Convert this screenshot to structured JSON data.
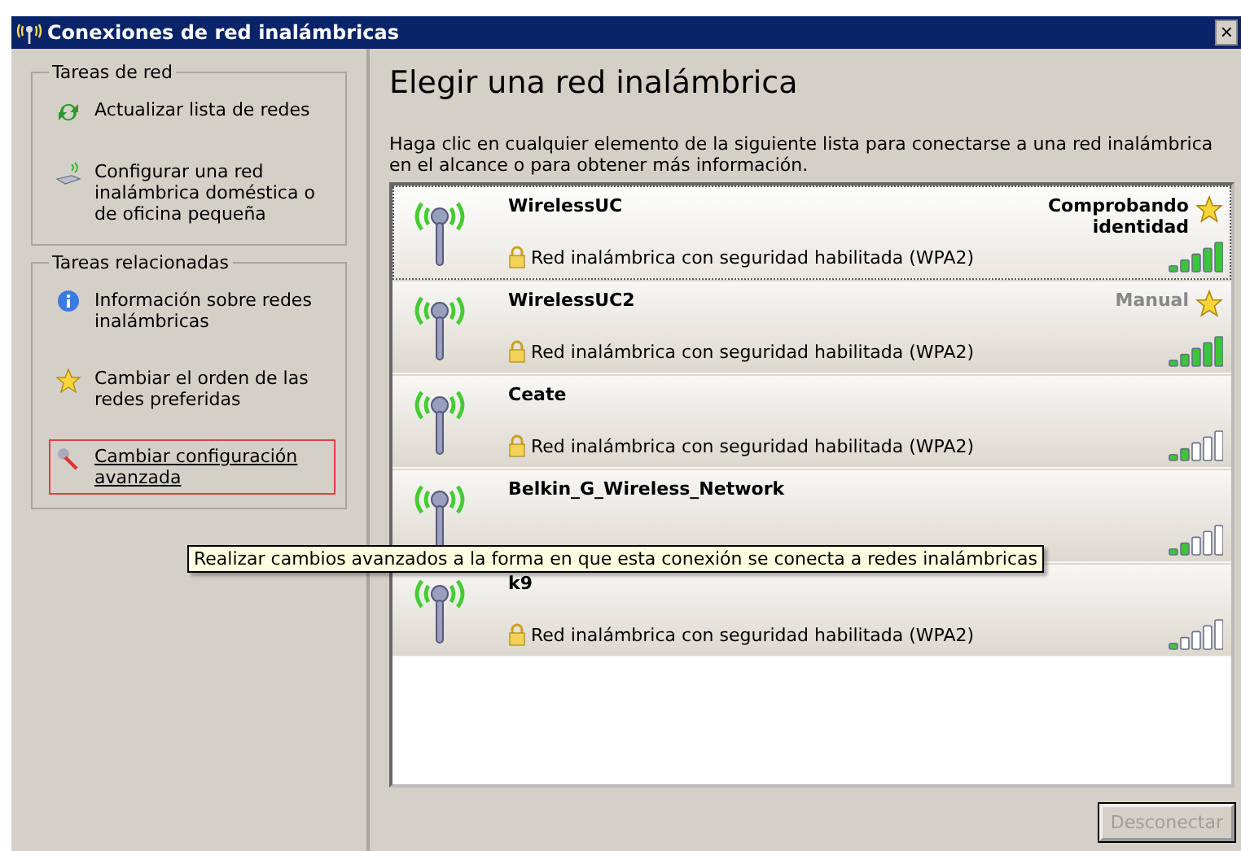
{
  "window": {
    "title": "Conexiones de red inalámbricas",
    "close": "×"
  },
  "sidebar": [
    {
      "title": "Tareas de red",
      "items": [
        {
          "kind": "refresh",
          "label": "Actualizar lista de redes",
          "highlighted": false
        },
        {
          "kind": "setup",
          "label": "Configurar una red inalámbrica doméstica o de oficina pequeña",
          "highlighted": false
        }
      ]
    },
    {
      "title": "Tareas relacionadas",
      "items": [
        {
          "kind": "info",
          "label": "Información sobre redes inalámbricas",
          "highlighted": false
        },
        {
          "kind": "star",
          "label": "Cambiar el orden de las redes preferidas",
          "highlighted": false
        },
        {
          "kind": "tools",
          "label": "Cambiar configuración avanzada",
          "highlighted": true
        }
      ]
    }
  ],
  "heading": "Elegir una red inalámbrica",
  "description": "Haga clic en cualquier elemento de la siguiente lista para conectarse a una red inalámbrica en el alcance o para obtener más información.",
  "networks": [
    {
      "name": "WirelessUC",
      "security": "Red inalámbrica con seguridad habilitada (WPA2)",
      "status": "Comprobando identidad",
      "kind": "active",
      "preferred": true,
      "level": 1,
      "selected": true
    },
    {
      "name": "WirelessUC2",
      "security": "Red inalámbrica con seguridad habilitada (WPA2)",
      "status": "Manual",
      "kind": "muted",
      "preferred": true,
      "level": 1,
      "selected": false
    },
    {
      "name": "Ceate",
      "security": "Red inalámbrica con seguridad habilitada (WPA2)",
      "preferred": false,
      "level": 0.4,
      "selected": false
    },
    {
      "name": "Belkin_G_Wireless_Network",
      "preferred": false,
      "level": 0.4,
      "selected": false
    },
    {
      "name": "k9",
      "security": "Red inalámbrica con seguridad habilitada (WPA2)",
      "preferred": false,
      "level": 0.2,
      "selected": false
    }
  ],
  "tooltip": "Realizar cambios avanzados a la forma en que esta conexión se conecta a redes inalámbricas",
  "buttons": [
    {
      "label": "Desconectar",
      "disabled": true
    }
  ]
}
